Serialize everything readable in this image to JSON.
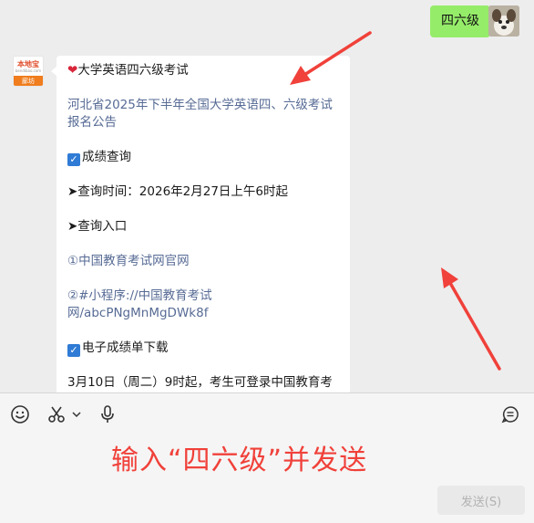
{
  "sent_message": {
    "text": "四六级"
  },
  "account": {
    "brand": "本地宝",
    "url": "bendibao.com",
    "city_tag": "廊坊"
  },
  "reply": {
    "title": "大学英语四六级考试",
    "link_announcement": "河北省2025年下半年全国大学英语四、六级考试报名公告",
    "section_scores": "成绩查询",
    "query_time": "➤查询时间：2026年2月27日上午6时起",
    "query_entry": "➤查询入口",
    "entry1": "①中国教育考试网官网",
    "entry2_prefix": "②",
    "entry2_link": "#小程序://中国教育考试网/abcPNgMnMgDWk8f",
    "section_download": "电子成绩单下载",
    "download_text": "3月10日（周二）9时起，考生可登录中国教育考"
  },
  "input": {
    "typed_annotation": "输入“四六级”并发送"
  },
  "send_button": {
    "label": "发送(S)"
  },
  "colors": {
    "sent_bubble": "#95ec69",
    "link": "#576b95",
    "annotation_red": "#f0413a"
  },
  "icons": [
    "heart-icon",
    "checkbox-icon",
    "emoji-icon",
    "scissors-icon",
    "chevron-down-icon",
    "microphone-icon",
    "chat-history-icon"
  ]
}
